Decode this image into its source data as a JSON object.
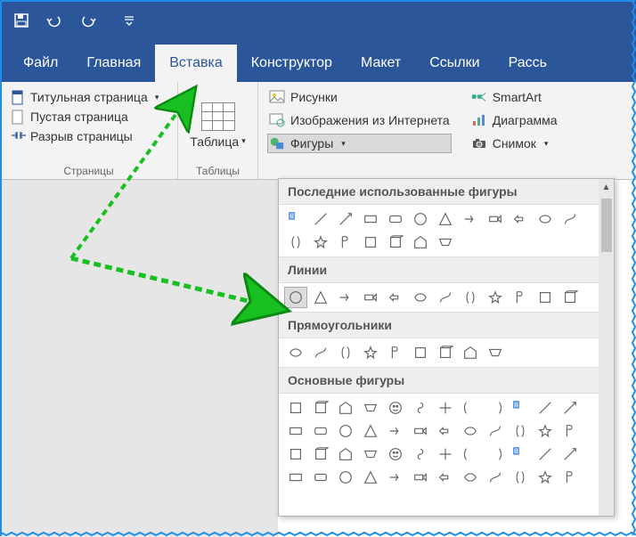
{
  "tabs": [
    "Файл",
    "Главная",
    "Вставка",
    "Конструктор",
    "Макет",
    "Ссылки",
    "Рассь"
  ],
  "active_tab": 2,
  "pages_group": {
    "label": "Страницы",
    "items": [
      "Титульная страница",
      "Пустая страница",
      "Разрыв страницы"
    ]
  },
  "tables_group": {
    "label": "Таблицы",
    "button": "Таблица"
  },
  "illustrations": {
    "left": [
      "Рисунки",
      "Изображения из Интернета",
      "Фигуры"
    ],
    "right": [
      "SmartArt",
      "Диаграмма",
      "Снимок"
    ]
  },
  "shapes_dropdown": {
    "sections": [
      {
        "title": "Последние использованные фигуры",
        "rows": 2,
        "cols": 12,
        "highlight": -1
      },
      {
        "title": "Линии",
        "rows": 1,
        "cols": 12,
        "highlight": 0
      },
      {
        "title": "Прямоугольники",
        "rows": 1,
        "cols": 9,
        "highlight": -1
      },
      {
        "title": "Основные фигуры",
        "rows": 4,
        "cols": 12,
        "highlight": -1
      }
    ]
  }
}
